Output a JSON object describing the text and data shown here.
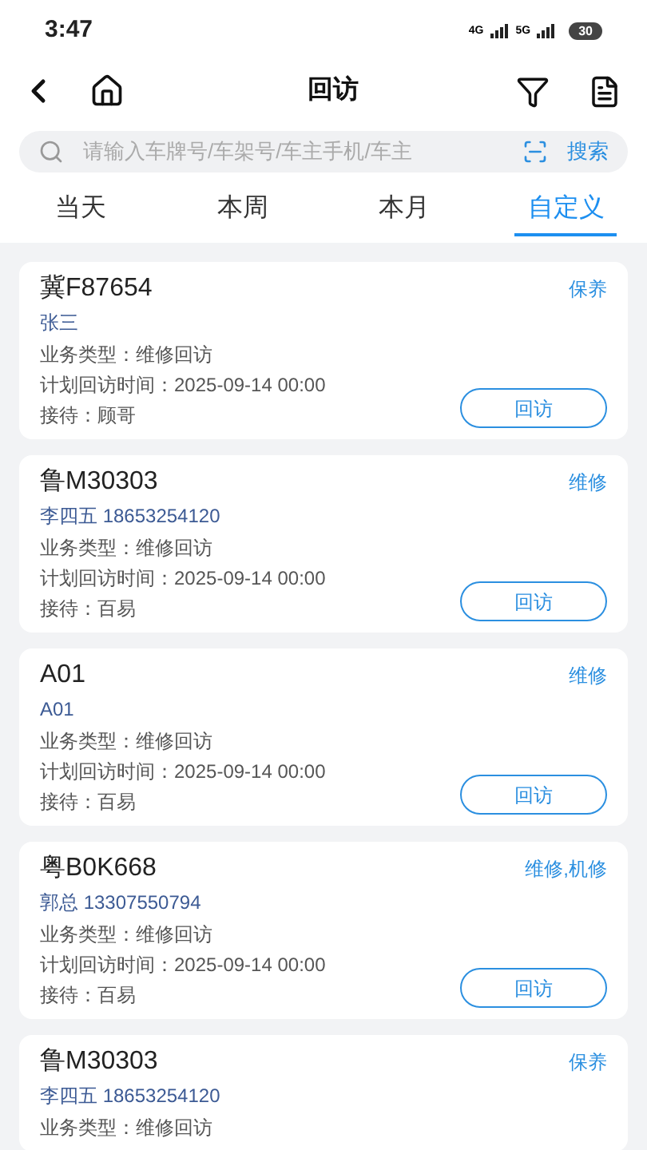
{
  "status_bar": {
    "time": "3:47",
    "network_1": "4G",
    "network_2": "5G",
    "battery": "30"
  },
  "header": {
    "title": "回访"
  },
  "search": {
    "placeholder": "请输入车牌号/车架号/车主手机/车主",
    "button": "搜索"
  },
  "tabs": [
    {
      "label": "当天",
      "selected": false
    },
    {
      "label": "本周",
      "selected": false
    },
    {
      "label": "本月",
      "selected": false
    },
    {
      "label": "自定义",
      "selected": true
    }
  ],
  "records": [
    {
      "plate": "冀F87654",
      "owner": "张三",
      "tag": "保养",
      "lines": [
        "业务类型：维修回访",
        "计划回访时间：2025-09-14 00:00",
        "接待：顾哥"
      ],
      "action": "回访"
    },
    {
      "plate": "鲁M30303",
      "owner": "李四五 18653254120",
      "tag": "维修",
      "lines": [
        "业务类型：维修回访",
        "计划回访时间：2025-09-14 00:00",
        "接待：百易"
      ],
      "action": "回访"
    },
    {
      "plate": "A01",
      "owner": "A01",
      "tag": "维修",
      "lines": [
        "业务类型：维修回访",
        "计划回访时间：2025-09-14 00:00",
        "接待：百易"
      ],
      "action": "回访"
    },
    {
      "plate": "粤B0K668",
      "owner": "郭总 13307550794",
      "tag": "维修,机修",
      "lines": [
        "业务类型：维修回访",
        "计划回访时间：2025-09-14 00:00",
        "接待：百易"
      ],
      "action": "回访"
    },
    {
      "plate": "鲁M30303",
      "owner": "李四五 18653254120",
      "tag": "保养",
      "lines": [
        "业务类型：维修回访"
      ]
    }
  ]
}
